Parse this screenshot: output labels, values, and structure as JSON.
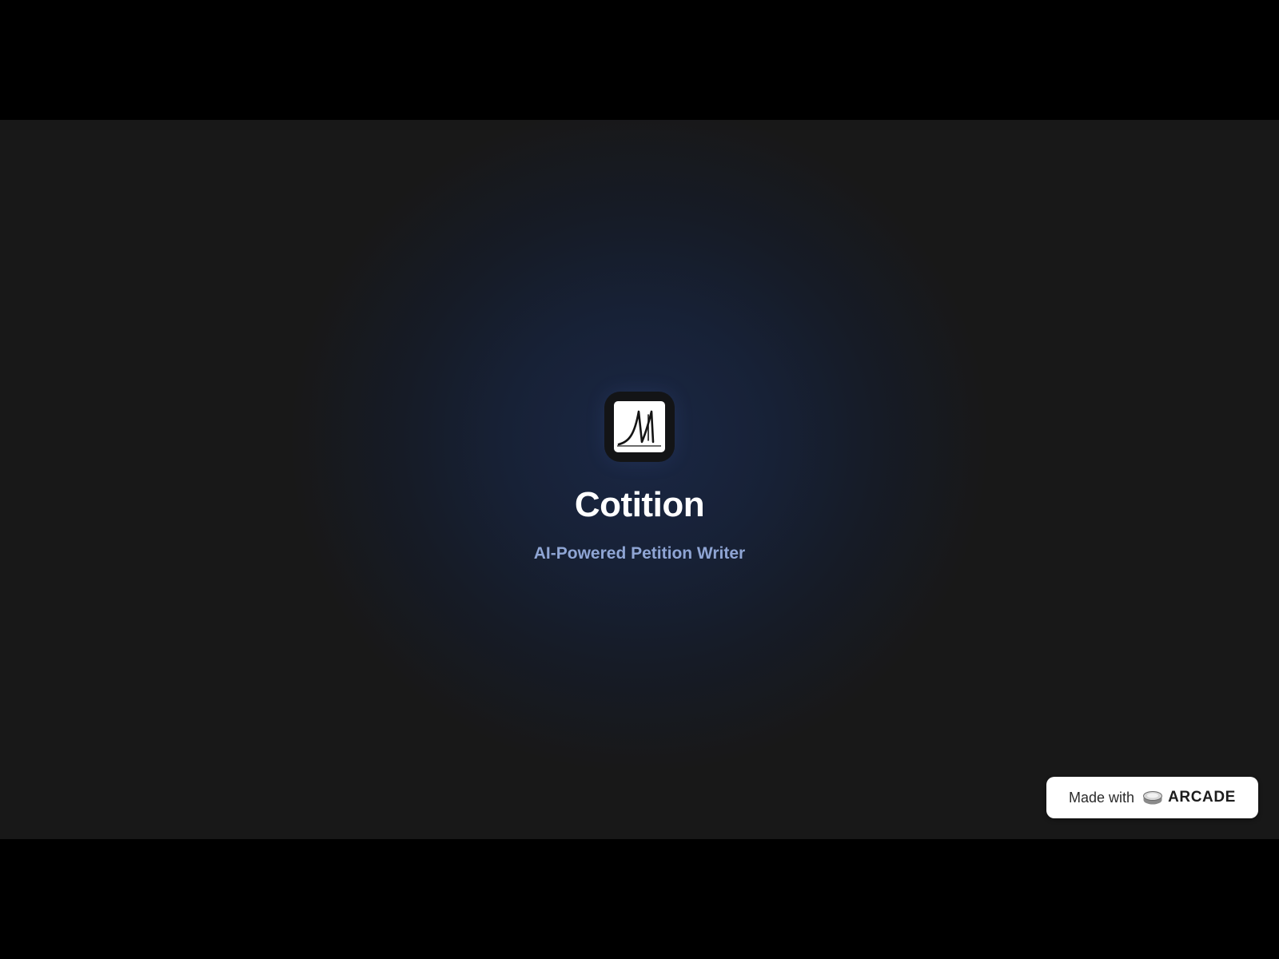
{
  "app": {
    "name": "Cotition",
    "tagline": "AI-Powered Petition Writer",
    "icon": "cotition-logo-icon"
  },
  "badge": {
    "prefix": "Made with",
    "brand": "ARCADE",
    "icon": "arcade-button-icon"
  },
  "colors": {
    "background": "#181818",
    "glow": "#1a2744",
    "title": "#ffffff",
    "tagline": "#8fa5d4",
    "badge_bg": "#ffffff"
  }
}
